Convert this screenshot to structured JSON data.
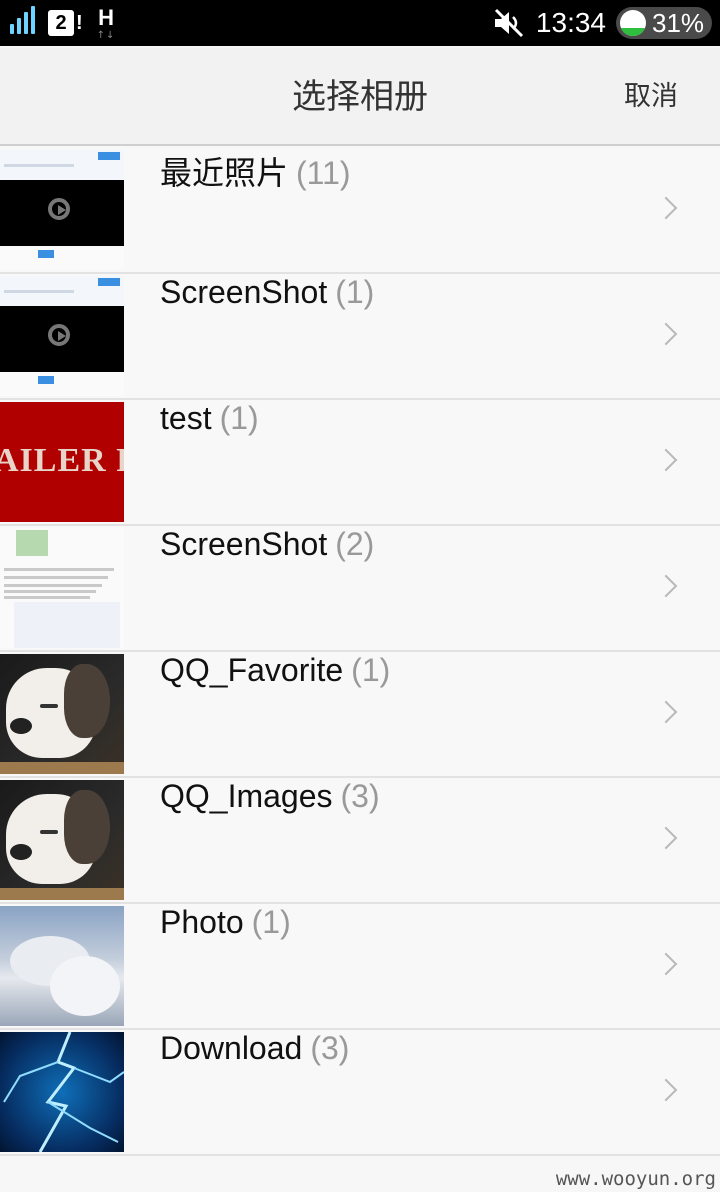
{
  "status_bar": {
    "sim_slot": "2",
    "sim_badge": "!",
    "network_type": "H",
    "network_arrows": "↑↓",
    "time": "13:34",
    "battery_percent_text": "31%",
    "battery_level": 0.31,
    "icons": [
      "signal-icon",
      "sim-card-icon",
      "network-h-icon",
      "muted-speaker-icon",
      "battery-icon"
    ]
  },
  "header": {
    "title": "选择相册",
    "cancel_label": "取消"
  },
  "albums": [
    {
      "name": "最近照片",
      "count": "(11)",
      "thumb": "video-screenshot"
    },
    {
      "name": "ScreenShot",
      "count": "(1)",
      "thumb": "video-screenshot"
    },
    {
      "name": "test",
      "count": "(1)",
      "thumb": "red-trailer-text",
      "thumb_text": "AILER R"
    },
    {
      "name": "ScreenShot",
      "count": "(2)",
      "thumb": "chat-screenshot"
    },
    {
      "name": "QQ_Favorite",
      "count": "(1)",
      "thumb": "puppy-photo"
    },
    {
      "name": "QQ_Images",
      "count": "(3)",
      "thumb": "puppy-photo"
    },
    {
      "name": "Photo",
      "count": "(1)",
      "thumb": "cloud-photo"
    },
    {
      "name": "Download",
      "count": "(3)",
      "thumb": "lightning-photo"
    }
  ],
  "watermark": "www.wooyun.org",
  "colors": {
    "status_bar_bg": "#000000",
    "header_bg": "#f2f2f2",
    "list_bg": "#f8f8f8",
    "count_text": "#999999",
    "chevron": "#b9b9b9",
    "battery_fill": "#2ebd3c"
  }
}
